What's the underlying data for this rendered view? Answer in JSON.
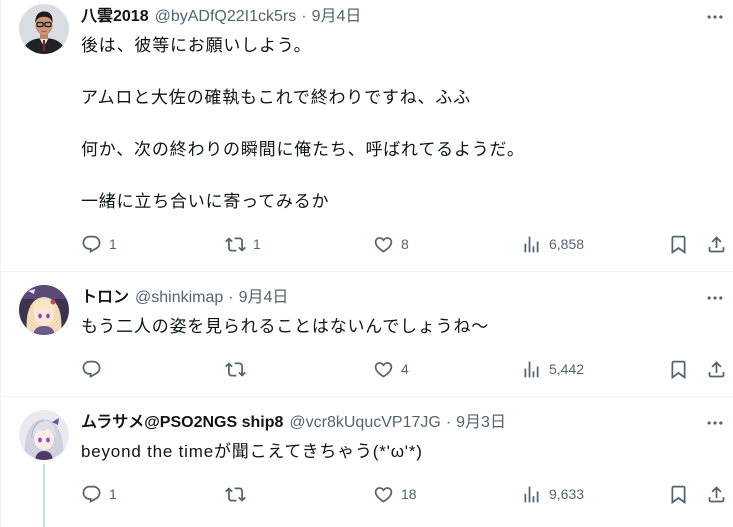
{
  "colors": {
    "text": "#0f1419",
    "secondary": "#536471",
    "border": "#eff3f4",
    "thread_line": "#cfd9de",
    "background": "#ffffff"
  },
  "tweets": [
    {
      "name": "八雲2018",
      "handle": "@byADfQ22I1ck5rs",
      "dot": "·",
      "date": "9月4日",
      "more_icon": "more-icon",
      "paragraphs": [
        "後は、彼等にお願いしよう。",
        "アムロと大佐の確執もこれで終わりですね、ふふ",
        "何か、次の終わりの瞬間に俺たち、呼ばれてるようだ。",
        "一緒に立ち合いに寄ってみるか"
      ],
      "actions": {
        "reply": {
          "icon": "reply-icon",
          "count": "1"
        },
        "retweet": {
          "icon": "retweet-icon",
          "count": "1"
        },
        "like": {
          "icon": "heart-icon",
          "count": "8"
        },
        "views": {
          "icon": "views-icon",
          "count": "6,858"
        },
        "bookmark": {
          "icon": "bookmark-icon"
        },
        "share": {
          "icon": "share-icon"
        }
      }
    },
    {
      "name": "トロン",
      "handle": "@shinkimap",
      "dot": "·",
      "date": "9月4日",
      "more_icon": "more-icon",
      "paragraphs": [
        "もう二人の姿を見られることはないんでしょうね～"
      ],
      "actions": {
        "reply": {
          "icon": "reply-icon"
        },
        "retweet": {
          "icon": "retweet-icon"
        },
        "like": {
          "icon": "heart-icon",
          "count": "4"
        },
        "views": {
          "icon": "views-icon",
          "count": "5,442"
        },
        "bookmark": {
          "icon": "bookmark-icon"
        },
        "share": {
          "icon": "share-icon"
        }
      }
    },
    {
      "name": "ムラサメ@PSO2NGS ship8",
      "handle": "@vcr8kUqucVP17JG",
      "dot": "·",
      "date": "9月3日",
      "more_icon": "more-icon",
      "paragraphs": [
        "beyond the timeが聞こえてきちゃう(*'ω'*)"
      ],
      "actions": {
        "reply": {
          "icon": "reply-icon",
          "count": "1"
        },
        "retweet": {
          "icon": "retweet-icon"
        },
        "like": {
          "icon": "heart-icon",
          "count": "18"
        },
        "views": {
          "icon": "views-icon",
          "count": "9,633"
        },
        "bookmark": {
          "icon": "bookmark-icon"
        },
        "share": {
          "icon": "share-icon"
        }
      }
    }
  ]
}
